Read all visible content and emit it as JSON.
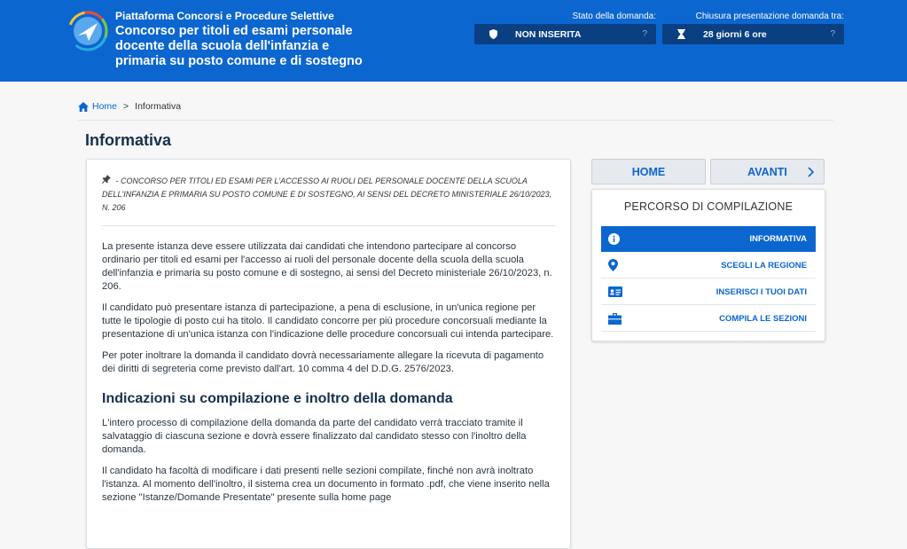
{
  "header": {
    "platform_name": "Piattaforma Concorsi e Procedure Selettive",
    "competition_title": "Concorso per titoli ed esami personale docente della scuola dell'infanzia e primaria su posto comune e di sostegno",
    "status": {
      "label": "Stato della domanda:",
      "value": "NON INSERITA",
      "help": "?"
    },
    "deadline": {
      "label": "Chiusura presentazione domanda tra:",
      "value": "28 giorni 6 ore",
      "help": "?"
    }
  },
  "breadcrumb": {
    "home": "Home",
    "separator": ">",
    "current": "Informativa"
  },
  "page_title": "Informativa",
  "main": {
    "decree": "- CONCORSO PER TITOLI ED ESAMI PER L'ACCESSO AI RUOLI DEL PERSONALE DOCENTE DELLA SCUOLA DELL'INFANZIA E PRIMARIA SU POSTO COMUNE E DI SOSTEGNO, AI SENSI DEL DECRETO MINISTERIALE 26/10/2023, N. 206",
    "paragraphs": [
      "La presente istanza deve essere utilizzata dai candidati che intendono partecipare al concorso ordinario per titoli ed esami per l'accesso ai ruoli del personale docente della scuola della scuola dell'infanzia e primaria su posto comune e di sostegno, ai sensi del Decreto ministeriale 26/10/2023, n. 206.",
      "Il candidato può presentare istanza di partecipazione, a pena di esclusione, in un'unica regione per tutte le tipologie di posto cui ha titolo. Il candidato concorre per più procedure concorsuali mediante la presentazione di un'unica istanza con l'indicazione delle procedure concorsuali cui intenda partecipare.",
      "Per poter inoltrare la domanda il candidato dovrà necessariamente allegare la ricevuta di pagamento dei diritti di segreteria come previsto dall'art. 10 comma 4 del D.D.G. 2576/2023."
    ],
    "section_heading": "Indicazioni su compilazione e inoltro della domanda",
    "section_paragraphs": [
      "L'intero processo di compilazione della domanda da parte del candidato verrà tracciato tramite il salvataggio di ciascuna sezione e dovrà essere finalizzato dal candidato stesso con l'inoltro della domanda.",
      "Il candidato ha facoltà di modificare i dati presenti nelle sezioni compilate, finché non avrà inoltrato l'istanza. Al momento dell'inoltro, il sistema crea un documento in formato .pdf, che viene inserito nella sezione \"Istanze/Domande Presentate\" presente sulla home page"
    ]
  },
  "sidebar": {
    "home_button": "HOME",
    "next_button": "AVANTI",
    "steps_title": "PERCORSO DI COMPILAZIONE",
    "steps": [
      {
        "label": "INFORMATIVA",
        "icon": "info-icon",
        "active": true
      },
      {
        "label": "SCEGLI LA REGIONE",
        "icon": "map-pin-icon",
        "active": false
      },
      {
        "label": "INSERISCI I TUOI DATI",
        "icon": "id-card-icon",
        "active": false
      },
      {
        "label": "COMPILA LE SEZIONI",
        "icon": "briefcase-icon",
        "active": false
      }
    ]
  },
  "colors": {
    "header_bg": "#0c66cf",
    "status_box_bg": "#0a3f82",
    "accent": "#0c66cf",
    "heading": "#16304d"
  }
}
